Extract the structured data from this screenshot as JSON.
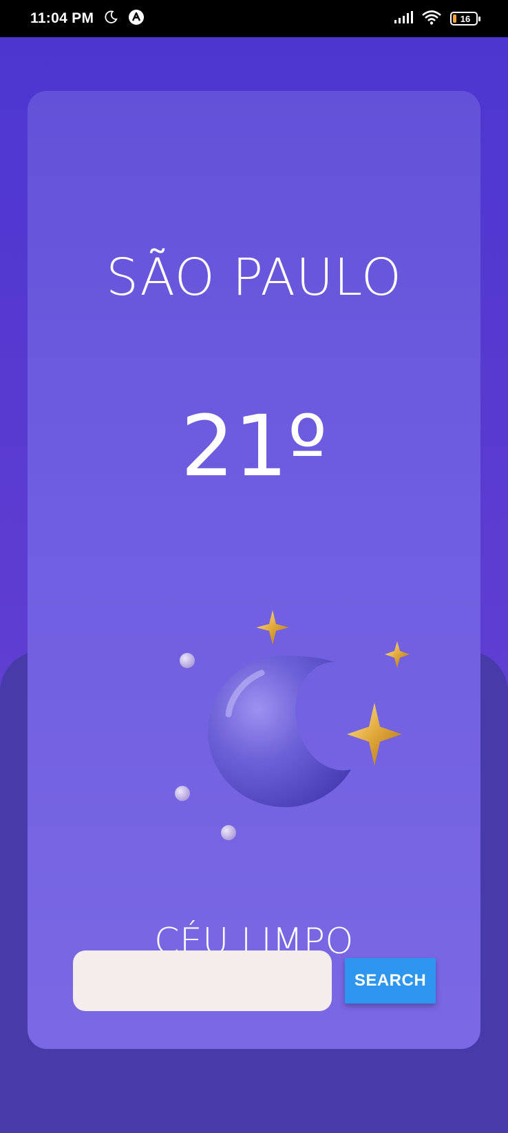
{
  "status_bar": {
    "time": "11:04 PM",
    "battery_level": "16",
    "icons": [
      "moon-icon",
      "app-notification-icon",
      "signal-icon",
      "wifi-icon",
      "battery-icon"
    ]
  },
  "weather": {
    "city": "SÃO PAULO",
    "temperature": "21º",
    "description": "CÉU LIMPO",
    "icon": "moon-stars-icon"
  },
  "search": {
    "input_value": "",
    "placeholder": "",
    "button_label": "SEARCH"
  },
  "colors": {
    "background": "#4b36cf",
    "lower_background": "#463ba9",
    "card_top": "#6352d9",
    "card_bottom": "#7a68e4",
    "input_background": "#f5edeb",
    "button": "#2f96ef"
  }
}
